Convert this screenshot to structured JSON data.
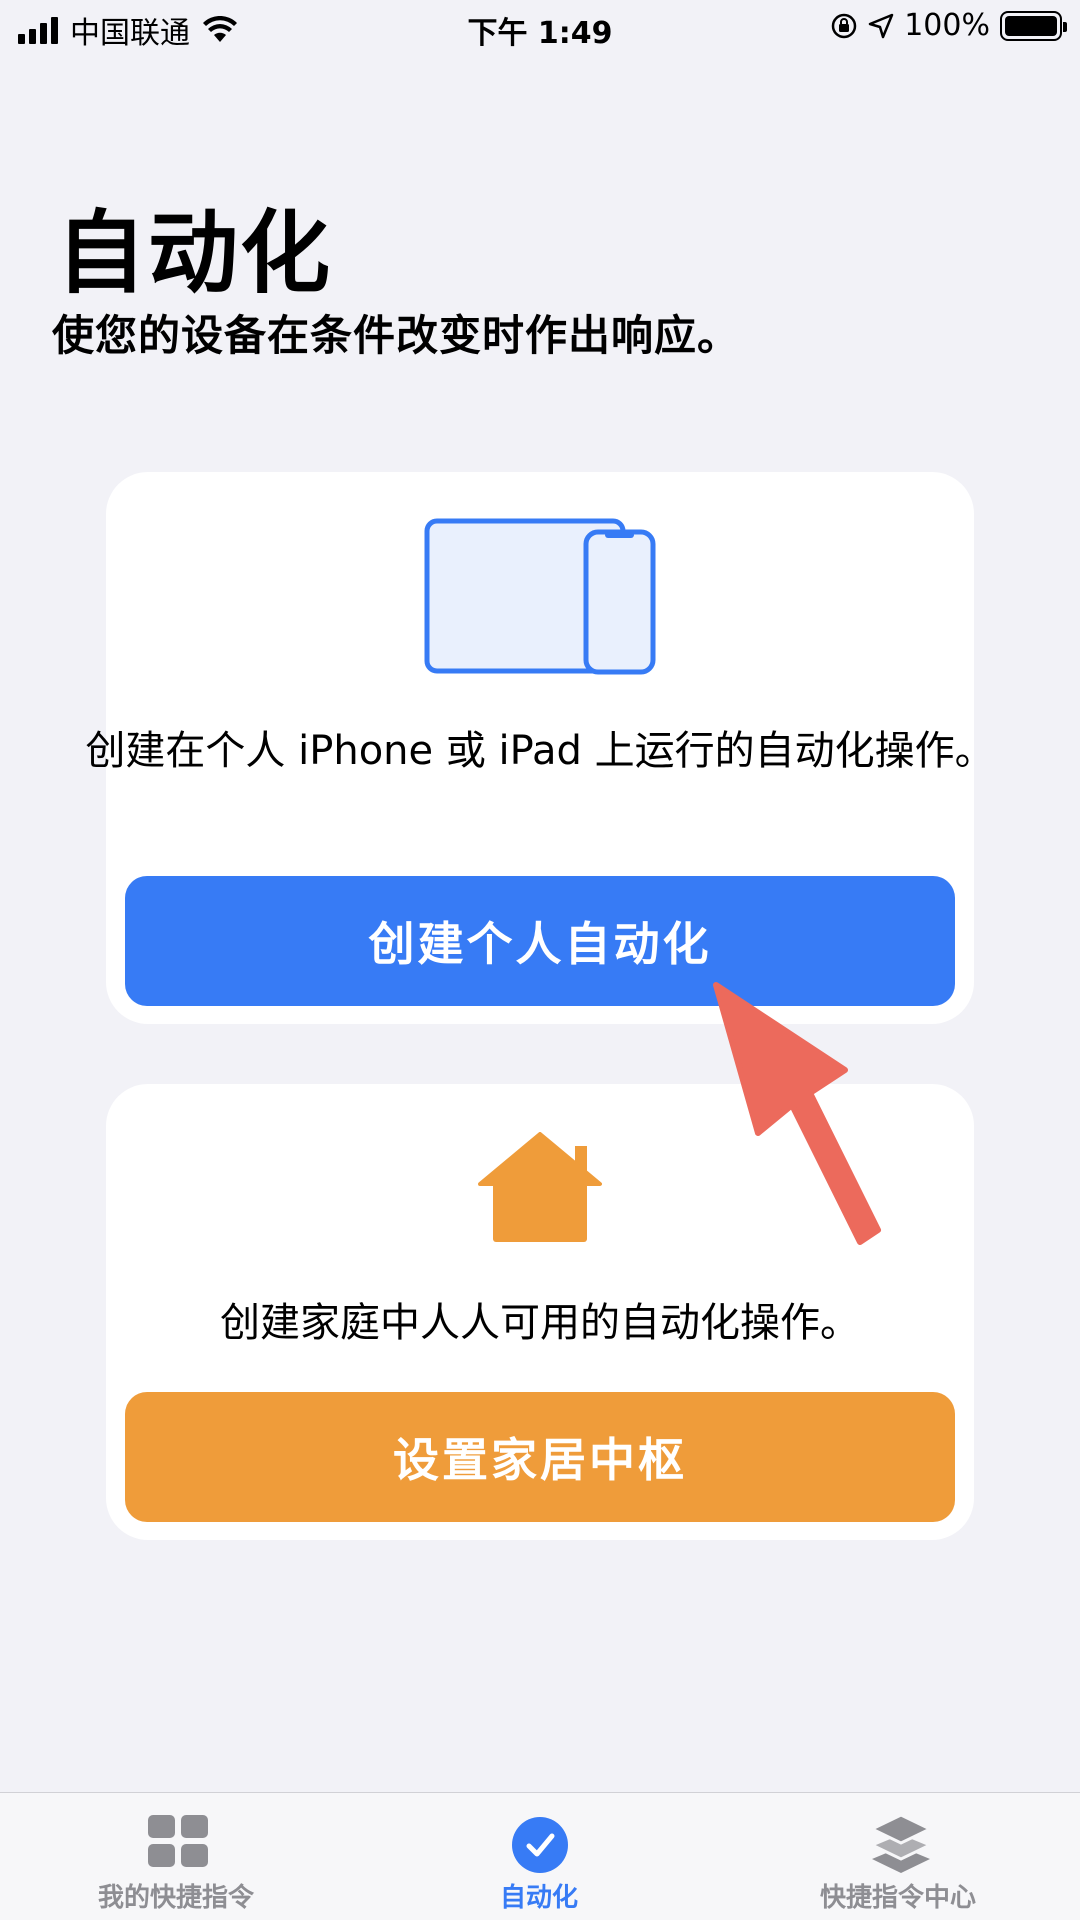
{
  "status_bar": {
    "carrier": "中国联通",
    "time": "下午 1:49",
    "battery": "100%"
  },
  "header": {
    "title": "自动化",
    "subtitle": "使您的设备在条件改变时作出响应。"
  },
  "personal_card": {
    "description": "创建在个人 iPhone 或 iPad 上运行的自动化操作。",
    "button_label": "创建个人自动化",
    "icon": "iphone-ipad-icon"
  },
  "home_card": {
    "description": "创建家庭中人人可用的自动化操作。",
    "button_label": "设置家居中枢",
    "icon": "home-icon"
  },
  "tab_bar": {
    "tabs": [
      {
        "label": "我的快捷指令",
        "icon": "grid-icon",
        "active": false
      },
      {
        "label": "自动化",
        "icon": "check-circle-icon",
        "active": true
      },
      {
        "label": "快捷指令中心",
        "icon": "layers-icon",
        "active": false
      }
    ]
  },
  "colors": {
    "accent_blue": "#377bf5",
    "home_orange": "#ef9c3a",
    "annotation_arrow": "#ec6a5c",
    "background": "#f2f2f7"
  }
}
